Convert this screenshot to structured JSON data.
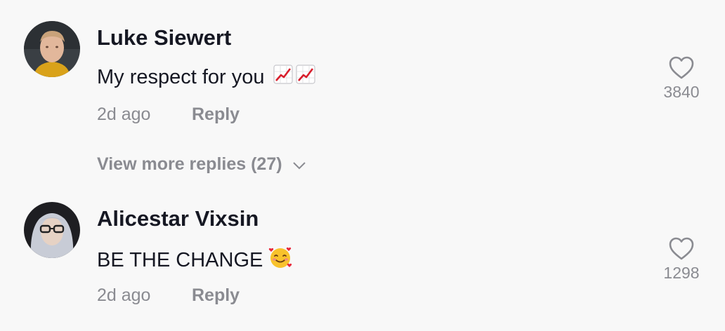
{
  "comments": [
    {
      "author": "Luke Siewert",
      "text": "My respect for you",
      "emoji": [
        "chart-increasing-icon",
        "chart-increasing-icon"
      ],
      "time": "2d ago",
      "reply_label": "Reply",
      "likes": "3840"
    },
    {
      "author": "Alicestar Vixsin",
      "text": "BE THE CHANGE",
      "emoji": [
        "smiling-face-with-hearts-icon"
      ],
      "time": "2d ago",
      "reply_label": "Reply",
      "likes": "1298"
    }
  ],
  "view_more": {
    "label": "View more replies (27)",
    "icon": "chevron-down-icon"
  },
  "colors": {
    "background": "#f8f8f8",
    "primary_text": "#161823",
    "secondary_text": "#8a8b91"
  }
}
